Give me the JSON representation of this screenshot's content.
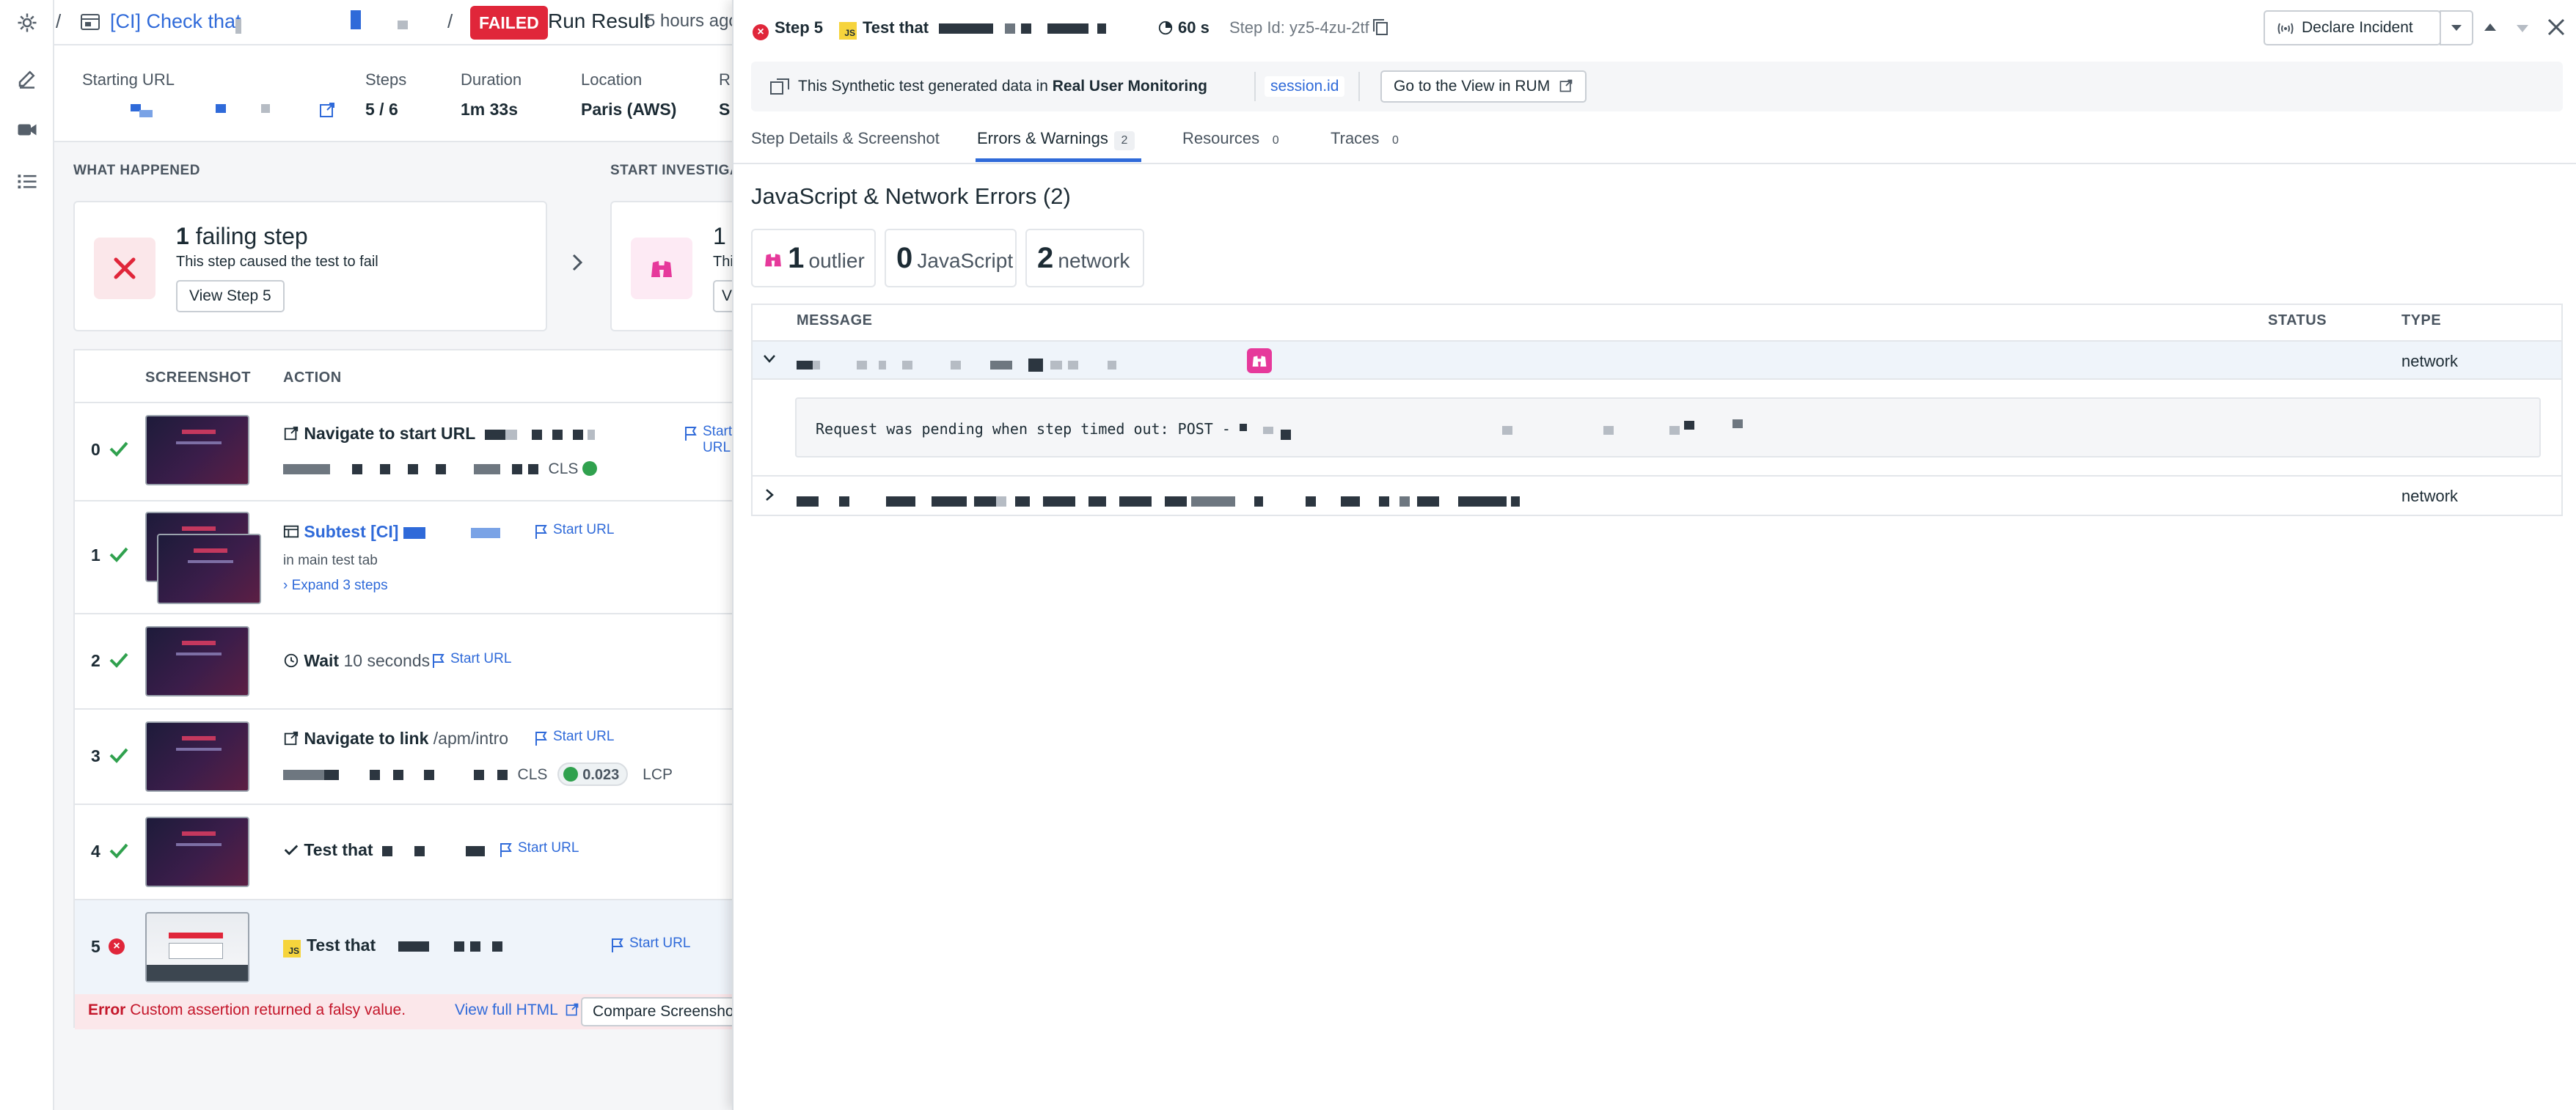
{
  "breadcrumb": {
    "sep": "/",
    "test_name": "[CI] Check that",
    "status": "FAILED",
    "title": "Run Result",
    "time": "5 hours ago"
  },
  "summary": {
    "starting_url_label": "Starting URL",
    "steps_label": "Steps",
    "steps_value": "5 / 6",
    "duration_label": "Duration",
    "duration_value": "1m 33s",
    "location_label": "Location",
    "location_value": "Paris (AWS)",
    "extra_label": "R",
    "extra_value": "S"
  },
  "what_happened": {
    "heading": "WHAT HAPPENED",
    "title_count": "1",
    "title_text": "failing step",
    "desc": "This step caused the test to fail",
    "button": "View Step 5"
  },
  "investigate": {
    "heading": "START INVESTIGAT",
    "title": "1",
    "desc": "This",
    "button": "V"
  },
  "steps_table": {
    "col_screenshot": "SCREENSHOT",
    "col_action": "ACTION",
    "start_url": "Start URL",
    "rows": [
      {
        "num": "0",
        "verb": "Navigate to start URL",
        "metric": "CLS"
      },
      {
        "num": "1",
        "verb": "Subtest [CI]",
        "sub": "in main test tab",
        "expand": "Expand 3 steps"
      },
      {
        "num": "2",
        "verb": "Wait",
        "detail": "10 seconds"
      },
      {
        "num": "3",
        "verb": "Navigate to link",
        "detail": "/apm/intro",
        "metric": "CLS",
        "metric_value": "0.023",
        "metric2": "LCP"
      },
      {
        "num": "4",
        "verb": "Test that"
      },
      {
        "num": "5",
        "verb": "Test that"
      }
    ],
    "error_label": "Error",
    "error_text": "Custom assertion returned a falsy value.",
    "view_html": "View full HTML",
    "compare": "Compare Screensho"
  },
  "panel": {
    "step": "Step 5",
    "js_badge": "JS",
    "step_name": "Test that",
    "duration": "60 s",
    "step_id": "Step Id: yz5-4zu-2tf",
    "declare": "Declare Incident",
    "rum_text_prefix": "This Synthetic test generated data in ",
    "rum_text_bold": "Real User Monitoring",
    "session": "session.id",
    "go_rum": "Go to the View in RUM",
    "tabs": [
      {
        "label": "Step Details & Screenshot",
        "count": ""
      },
      {
        "label": "Errors & Warnings",
        "count": "2"
      },
      {
        "label": "Resources",
        "count": "0"
      },
      {
        "label": "Traces",
        "count": "0"
      }
    ],
    "section_title": "JavaScript & Network Errors (2)",
    "stats": [
      {
        "n": "1",
        "w": "outlier"
      },
      {
        "n": "0",
        "w": "JavaScript"
      },
      {
        "n": "2",
        "w": "network"
      }
    ],
    "table": {
      "col_message": "MESSAGE",
      "col_status": "STATUS",
      "col_type": "TYPE",
      "row1_type": "network",
      "row1_detail": "Request was pending when step timed out: POST -",
      "row2_type": "network"
    }
  },
  "colors": {
    "accent": "#2f6ad9",
    "failed": "#e0263a",
    "success": "#30a14e",
    "outlier": "#e6399b",
    "js": "#f6d43c"
  }
}
